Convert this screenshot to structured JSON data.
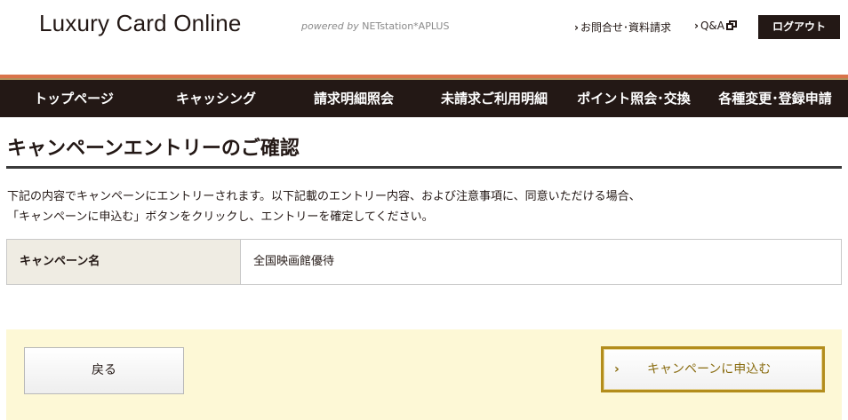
{
  "header": {
    "logo": "Luxury Card Online",
    "powered_prefix": "powered by",
    "powered_name": "NETstation*APLUS",
    "inquiry_label": "お問合せ･資料請求",
    "qa_label": "Q&A",
    "logout_label": "ログアウト",
    "chevron": "›"
  },
  "nav": {
    "items": [
      {
        "label": "トップページ"
      },
      {
        "label": "キャッシング"
      },
      {
        "label": "請求明細照会"
      },
      {
        "label": "未請求ご利用明細"
      },
      {
        "label": "ポイント照会･交換"
      },
      {
        "label": "各種変更･登録申請"
      }
    ]
  },
  "main": {
    "title": "キャンペーンエントリーのご確認",
    "intro_line1": "下記の内容でキャンペーンにエントリーされます。以下記載のエントリー内容、および注意事項に、同意いただける場合、",
    "intro_line2": "「キャンペーンに申込む」ボタンをクリックし、エントリーを確定してください。",
    "table": {
      "header": "キャンペーン名",
      "value": "全国映画館優待"
    },
    "back_label": "戻る",
    "apply_label": "キャンペーンに申込む",
    "apply_chevron": "›"
  },
  "colors": {
    "nav_bg": "#231815",
    "accent_gold": "#b38d1c",
    "stripe_orange": "#d9734a",
    "action_bg": "#fdf8d6",
    "table_header_bg": "#efece3"
  },
  "icons": {
    "qa": "external-window-icon"
  }
}
